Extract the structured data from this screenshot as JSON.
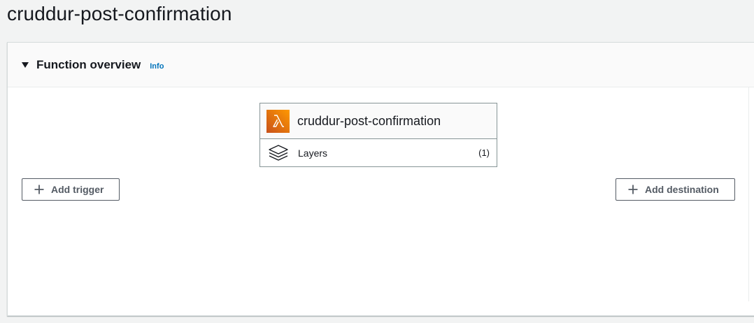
{
  "page": {
    "title": "cruddur-post-confirmation"
  },
  "function_overview": {
    "title": "Function overview",
    "info_link": "Info",
    "expanded": true,
    "function_card": {
      "name": "cruddur-post-confirmation",
      "icon": "lambda-icon",
      "layers": {
        "label": "Layers",
        "count": "(1)",
        "icon": "layers-icon"
      }
    },
    "add_trigger_label": "Add trigger",
    "add_destination_label": "Add destination"
  },
  "colors": {
    "page_background": "#f2f3f3",
    "panel_header_background": "#fafafa",
    "link": "#0073bb",
    "lambda_icon_start": "#c8511b",
    "lambda_icon_end": "#ff9900",
    "button_border": "#545b64"
  }
}
